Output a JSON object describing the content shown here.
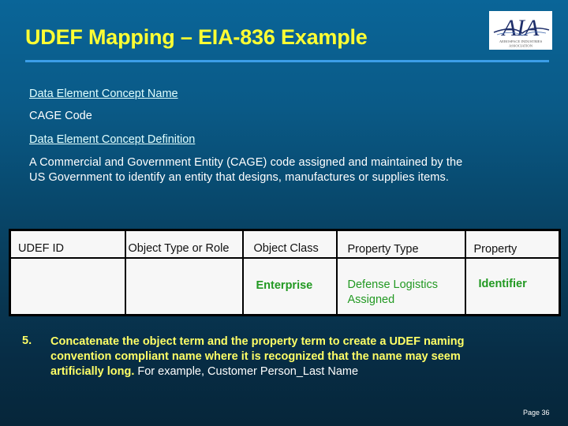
{
  "slide": {
    "title": "UDEF Mapping – EIA-836 Example",
    "logo": {
      "icon": "aia-logo-icon",
      "letters": "AIA",
      "tagline_line1": "AEROSPACE INDUSTRIES",
      "tagline_line2": "ASSOCIATION"
    },
    "colors": {
      "title": "#ffff33",
      "divider": "#3b9ee8",
      "section_label": "#e0ffff",
      "table_value": "#229922",
      "step_text": "#ffff66"
    }
  },
  "concept": {
    "name_label": "Data Element Concept Name",
    "name_value": "CAGE Code",
    "definition_label": "Data Element Concept Definition",
    "definition_lines": [
      "A Commercial and Government Entity (CAGE) code assigned and maintained by the",
      "US Government to identify an entity that designs, manufactures or supplies items."
    ]
  },
  "table": {
    "headers": [
      "UDEF ID",
      "Object Type or Role",
      "Object Class",
      "Property Type",
      "Property"
    ],
    "row": [
      "",
      "",
      "Enterprise",
      "Defense Logistics Assigned",
      "Identifier"
    ]
  },
  "step": {
    "number": "5.",
    "lines": [
      "Concatenate the object term and the property term to create a UDEF naming",
      "convention compliant name where it is recognized that the name may seem"
    ],
    "last_line_prefix": "artificially long.",
    "example": " For example, Customer Person_Last Name"
  },
  "footer": {
    "page": "Page 36"
  }
}
